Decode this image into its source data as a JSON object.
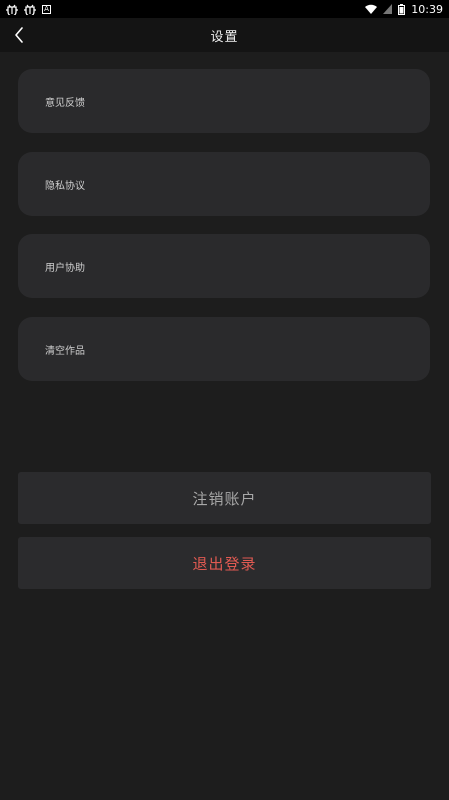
{
  "status_bar": {
    "time": "10:39",
    "left_icons": [
      "bug-icon",
      "bug-icon",
      "a-icon"
    ],
    "right_icons": [
      "wifi-icon",
      "signal-icon",
      "battery-icon"
    ]
  },
  "header": {
    "title": "设置",
    "back_icon": "chevron-left-icon"
  },
  "menu": {
    "items": [
      {
        "label": "意见反馈"
      },
      {
        "label": "隐私协议"
      },
      {
        "label": "用户协助"
      },
      {
        "label": "清空作品"
      }
    ]
  },
  "actions": {
    "cancel_account_label": "注销账户",
    "logout_label": "退出登录"
  },
  "colors": {
    "background": "#1d1d1d",
    "card": "#2a2a2c",
    "logout_text": "#e05a52",
    "cancel_text": "#a8a8a8"
  }
}
